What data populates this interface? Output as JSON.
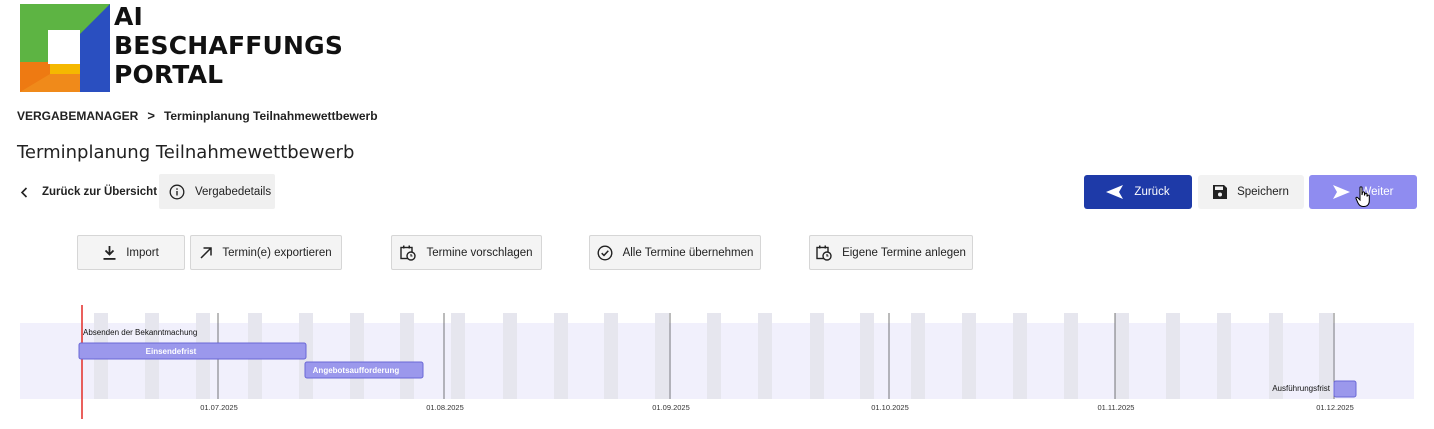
{
  "logo": {
    "line1": "AI",
    "line2": "BESCHAFFUNGS",
    "line3": "PORTAL",
    "colors": {
      "green": "#5db443",
      "blue": "#2a4fc0",
      "yellow": "#f5b800",
      "orange": "#ee7a12"
    }
  },
  "breadcrumb": {
    "root": "VERGABEMANAGER",
    "separator": ">",
    "current": "Terminplanung Teilnahmewettbewerb"
  },
  "page_title": "Terminplanung Teilnahmewettbewerb",
  "nav": {
    "back_label": "Zurück zur Übersicht",
    "details_label": "Vergabedetails"
  },
  "actions": {
    "zurueck": "Zurück",
    "speichern": "Speichern",
    "weiter": "Weiter",
    "colors": {
      "primary": "#1e3aa8",
      "secondary": "#8f8cf0"
    }
  },
  "toolbar": {
    "import": "Import",
    "export": "Termin(e) exportieren",
    "suggest": "Termine vorschlagen",
    "accept_all": "Alle Termine übernehmen",
    "create_own": "Eigene Termine anlegen"
  },
  "timeline": {
    "axis_labels": [
      "01.07.2025",
      "01.08.2025",
      "01.09.2025",
      "01.10.2025",
      "01.11.2025",
      "01.12.2025"
    ],
    "milestone_label": "Absenden der Bekanntmachung",
    "bars": [
      {
        "label": "Einsendefrist"
      },
      {
        "label": "Angebotsaufforderung"
      },
      {
        "label": "Ausführungsfrist"
      }
    ],
    "colors": {
      "bar": "#9b98ec",
      "bar_border": "#6a67d6",
      "band": "#f1f0fc",
      "today": "#e53935"
    }
  }
}
